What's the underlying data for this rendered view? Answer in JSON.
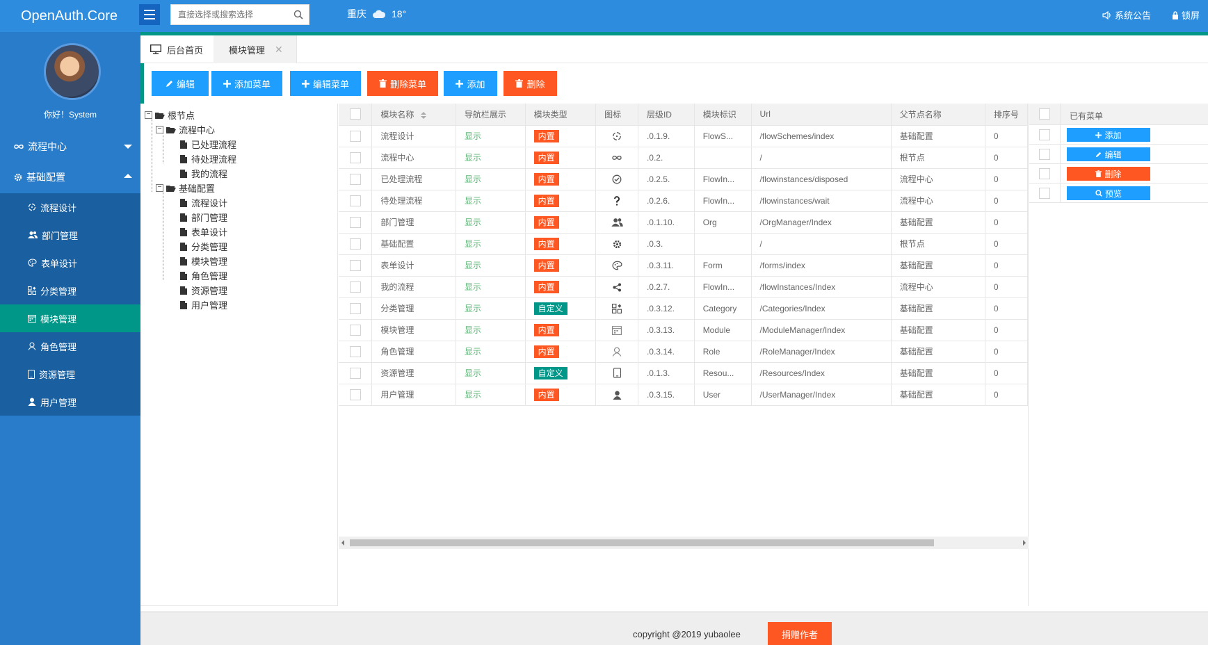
{
  "app": {
    "title": "OpenAuth.Core"
  },
  "header": {
    "search_placeholder": "直接选择或搜索选择",
    "weather_city": "重庆",
    "weather_temp": "18°",
    "notice_label": "系统公告",
    "lock_label": "锁屏"
  },
  "sidebar": {
    "greeting": "你好！System",
    "groups": [
      {
        "label": "流程中心",
        "expanded": false
      },
      {
        "label": "基础配置",
        "expanded": true
      }
    ],
    "items": [
      {
        "label": "流程设计",
        "icon": "flow-design-icon"
      },
      {
        "label": "部门管理",
        "icon": "users-icon"
      },
      {
        "label": "表单设计",
        "icon": "palette-icon"
      },
      {
        "label": "分类管理",
        "icon": "grid-icon"
      },
      {
        "label": "模块管理",
        "icon": "calendar-icon",
        "active": true
      },
      {
        "label": "角色管理",
        "icon": "user-outline-icon"
      },
      {
        "label": "资源管理",
        "icon": "phone-icon"
      },
      {
        "label": "用户管理",
        "icon": "user-icon"
      }
    ]
  },
  "tabs": [
    {
      "label": "后台首页"
    },
    {
      "label": "模块管理",
      "active": true
    }
  ],
  "toolbar": {
    "buttons": [
      {
        "label": "编辑",
        "color": "#1e9fff"
      },
      {
        "label": "添加菜单",
        "color": "#1e9fff"
      },
      {
        "label": "编辑菜单",
        "color": "#1e9fff"
      },
      {
        "label": "删除菜单",
        "color": "#ff5722"
      },
      {
        "label": "添加",
        "color": "#1e9fff"
      },
      {
        "label": "删除",
        "color": "#ff5722"
      }
    ]
  },
  "tree": {
    "root": "根节点",
    "groups": [
      {
        "label": "流程中心",
        "children": [
          "已处理流程",
          "待处理流程",
          "我的流程"
        ]
      },
      {
        "label": "基础配置",
        "children": [
          "流程设计",
          "部门管理",
          "表单设计",
          "分类管理",
          "模块管理",
          "角色管理",
          "资源管理",
          "用户管理"
        ]
      }
    ]
  },
  "table": {
    "columns": [
      "模块名称",
      "导航栏展示",
      "模块类型",
      "图标",
      "层级ID",
      "模块标识",
      "Url",
      "父节点名称",
      "排序号"
    ],
    "rows": [
      {
        "name": "流程设计",
        "nav": "显示",
        "type": "内置",
        "icon": "flow-design-icon",
        "cascade": ".0.1.9.",
        "code": "FlowS...",
        "url": "/flowSchemes/index",
        "parent": "基础配置",
        "sort": "0"
      },
      {
        "name": "流程中心",
        "nav": "显示",
        "type": "内置",
        "icon": "infinity-icon",
        "cascade": ".0.2.",
        "code": "",
        "url": "/",
        "parent": "根节点",
        "sort": "0"
      },
      {
        "name": "已处理流程",
        "nav": "显示",
        "type": "内置",
        "icon": "check-circle-icon",
        "cascade": ".0.2.5.",
        "code": "FlowIn...",
        "url": "/flowinstances/disposed",
        "parent": "流程中心",
        "sort": "0"
      },
      {
        "name": "待处理流程",
        "nav": "显示",
        "type": "内置",
        "icon": "question-icon",
        "cascade": ".0.2.6.",
        "code": "FlowIn...",
        "url": "/flowinstances/wait",
        "parent": "流程中心",
        "sort": "0"
      },
      {
        "name": "部门管理",
        "nav": "显示",
        "type": "内置",
        "icon": "users-icon",
        "cascade": ".0.1.10.",
        "code": "Org",
        "url": "/OrgManager/Index",
        "parent": "基础配置",
        "sort": "0"
      },
      {
        "name": "基础配置",
        "nav": "显示",
        "type": "内置",
        "icon": "gear-icon",
        "cascade": ".0.3.",
        "code": "",
        "url": "/",
        "parent": "根节点",
        "sort": "0"
      },
      {
        "name": "表单设计",
        "nav": "显示",
        "type": "内置",
        "icon": "palette-icon",
        "cascade": ".0.3.11.",
        "code": "Form",
        "url": "/forms/index",
        "parent": "基础配置",
        "sort": "0"
      },
      {
        "name": "我的流程",
        "nav": "显示",
        "type": "内置",
        "icon": "share-icon",
        "cascade": ".0.2.7.",
        "code": "FlowIn...",
        "url": "/flowInstances/Index",
        "parent": "流程中心",
        "sort": "0"
      },
      {
        "name": "分类管理",
        "nav": "显示",
        "type": "自定义",
        "icon": "grid-icon",
        "cascade": ".0.3.12.",
        "code": "Category",
        "url": "/Categories/Index",
        "parent": "基础配置",
        "sort": "0"
      },
      {
        "name": "模块管理",
        "nav": "显示",
        "type": "内置",
        "icon": "calendar-icon",
        "cascade": ".0.3.13.",
        "code": "Module",
        "url": "/ModuleManager/Index",
        "parent": "基础配置",
        "sort": "0"
      },
      {
        "name": "角色管理",
        "nav": "显示",
        "type": "内置",
        "icon": "user-outline-icon",
        "cascade": ".0.3.14.",
        "code": "Role",
        "url": "/RoleManager/Index",
        "parent": "基础配置",
        "sort": "0"
      },
      {
        "name": "资源管理",
        "nav": "显示",
        "type": "自定义",
        "icon": "phone-icon",
        "cascade": ".0.1.3.",
        "code": "Resou...",
        "url": "/Resources/Index",
        "parent": "基础配置",
        "sort": "0"
      },
      {
        "name": "用户管理",
        "nav": "显示",
        "type": "内置",
        "icon": "user-icon",
        "cascade": ".0.3.15.",
        "code": "User",
        "url": "/UserManager/Index",
        "parent": "基础配置",
        "sort": "0"
      }
    ]
  },
  "menu_panel": {
    "header": "已有菜单",
    "buttons": [
      {
        "label": "添加",
        "color": "#1e9fff",
        "icon": "plus-icon"
      },
      {
        "label": "编辑",
        "color": "#1e9fff",
        "icon": "pencil-icon"
      },
      {
        "label": "删除",
        "color": "#ff5722",
        "icon": "trash-icon"
      },
      {
        "label": "预览",
        "color": "#1e9fff",
        "icon": "search-icon"
      }
    ]
  },
  "footer": {
    "copyright": "copyright @2019 yubaolee",
    "donate_label": "捐赠作者"
  },
  "colors": {
    "primary": "#1e9fff",
    "danger": "#ff5722",
    "teal": "#009688",
    "sidebar": "#297cc9"
  }
}
